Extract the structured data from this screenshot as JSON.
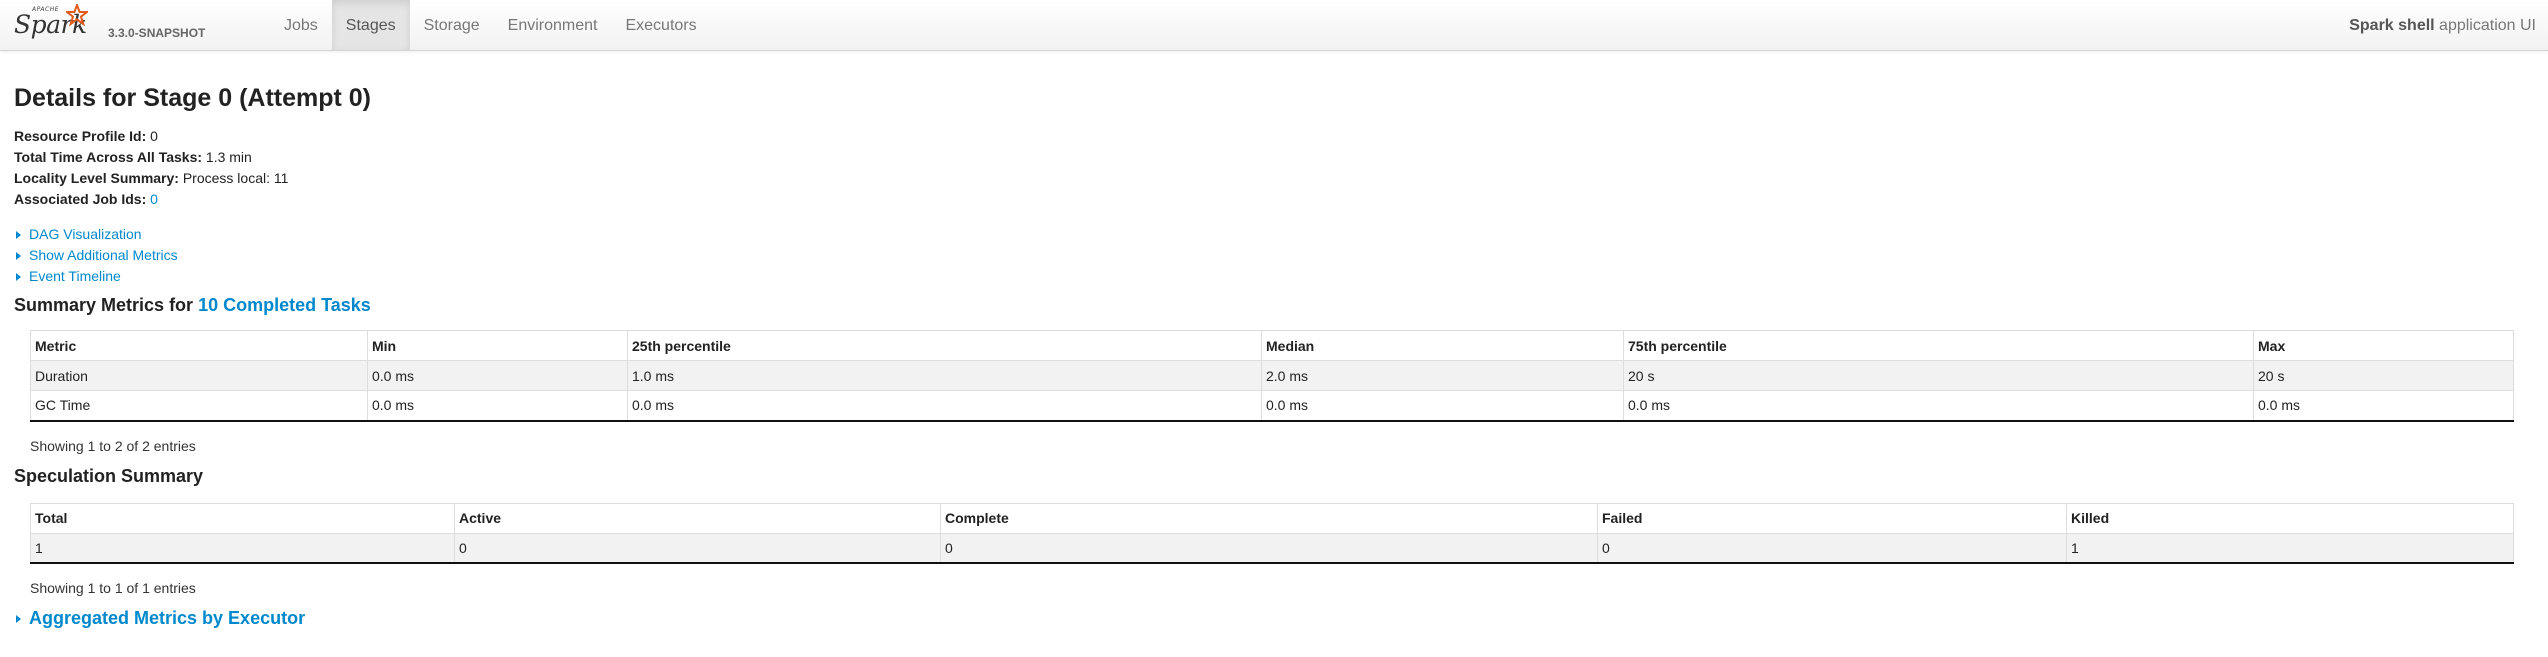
{
  "navbar": {
    "logo_small": "APACHE",
    "logo_text": "Spark",
    "version": "3.3.0-SNAPSHOT",
    "tabs": [
      {
        "label": "Jobs",
        "active": false
      },
      {
        "label": "Stages",
        "active": true
      },
      {
        "label": "Storage",
        "active": false
      },
      {
        "label": "Environment",
        "active": false
      },
      {
        "label": "Executors",
        "active": false
      }
    ],
    "app_name_bold": "Spark shell",
    "app_name_suffix": " application UI"
  },
  "stage": {
    "title": "Details for Stage 0 (Attempt 0)",
    "resource_profile_label": "Resource Profile Id:",
    "resource_profile_value": " 0",
    "total_time_label": "Total Time Across All Tasks:",
    "total_time_value": " 1.3 min",
    "locality_label": "Locality Level Summary:",
    "locality_value": " Process local: 11",
    "job_ids_label": "Associated Job Ids:",
    "job_ids_value": "0"
  },
  "expanders": {
    "dag": "DAG Visualization",
    "additional_metrics": "Show Additional Metrics",
    "event_timeline": "Event Timeline"
  },
  "summary_metrics": {
    "title_prefix": "Summary Metrics for ",
    "title_link": "10 Completed Tasks",
    "headers": [
      "Metric",
      "Min",
      "25th percentile",
      "Median",
      "75th percentile",
      "Max"
    ],
    "rows": [
      [
        "Duration",
        "0.0 ms",
        "1.0 ms",
        "2.0 ms",
        "20 s",
        "20 s"
      ],
      [
        "GC Time",
        "0.0 ms",
        "0.0 ms",
        "0.0 ms",
        "0.0 ms",
        "0.0 ms"
      ]
    ],
    "showing": "Showing 1 to 2 of 2 entries"
  },
  "speculation": {
    "title": "Speculation Summary",
    "headers": [
      "Total",
      "Active",
      "Complete",
      "Failed",
      "Killed"
    ],
    "rows": [
      [
        "1",
        "0",
        "0",
        "0",
        "1"
      ]
    ],
    "showing": "Showing 1 to 1 of 1 entries"
  },
  "aggregated": {
    "label": "Aggregated Metrics by Executor"
  },
  "colors": {
    "link": "#0088cc",
    "logo_star": "#e25a1c"
  }
}
